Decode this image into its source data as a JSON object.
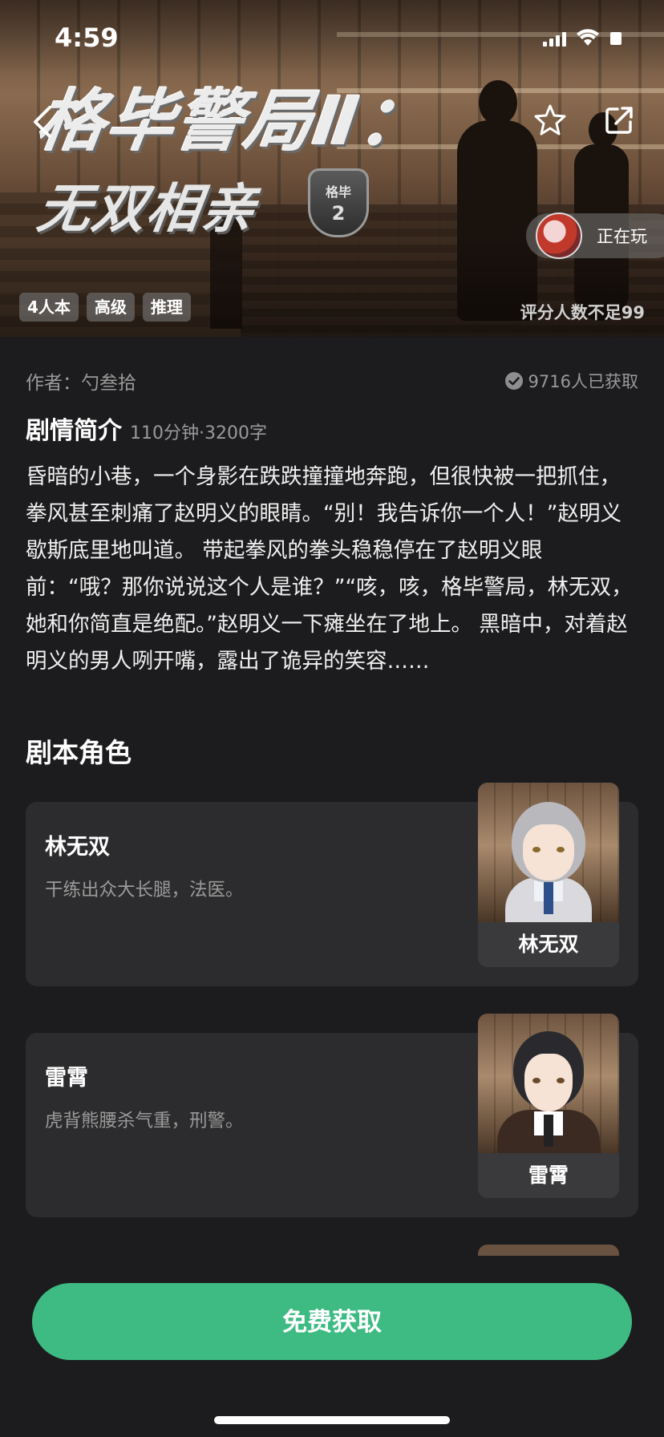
{
  "status_bar": {
    "time": "4:59"
  },
  "hero": {
    "title_line1": "格毕警局Ⅱ：",
    "title_line2": "无双相亲",
    "emblem_top": "格毕",
    "emblem_num": "2",
    "playing_label": "正在玩",
    "tags": [
      "4人本",
      "高级",
      "推理"
    ],
    "rating_note": "评分人数不足99"
  },
  "info": {
    "author": "作者：勺叁拾",
    "obtained": "9716人已获取"
  },
  "synopsis": {
    "title": "剧情简介",
    "meta": "110分钟·3200字",
    "text": "昏暗的小巷，一个身影在跌跌撞撞地奔跑，但很快被一把抓住，拳风甚至刺痛了赵明义的眼睛。“别！我告诉你一个人！”赵明义歇斯底里地叫道。 带起拳风的拳头稳稳停在了赵明义眼前：“哦？那你说说这个人是谁？”“咳，咳，格毕警局，林无双，她和你简直是绝配。”赵明义一下瘫坐在了地上。 黑暗中，对着赵明义的男人咧开嘴，露出了诡异的笑容……"
  },
  "roles": {
    "title": "剧本角色",
    "items": [
      {
        "name": "林无双",
        "desc": "干练出众大长腿，法医。",
        "portrait_label": "林无双"
      },
      {
        "name": "雷霄",
        "desc": "虎背熊腰杀气重，刑警。",
        "portrait_label": "雷霄"
      }
    ]
  },
  "action": {
    "get_label": "免费获取"
  },
  "colors": {
    "accent": "#3dbb83",
    "background": "#1c1c1e",
    "card": "#2c2c2e"
  },
  "icons": [
    "back-icon",
    "star-icon",
    "share-icon",
    "check-circle-icon",
    "signal-icon",
    "wifi-icon",
    "battery-icon"
  ]
}
